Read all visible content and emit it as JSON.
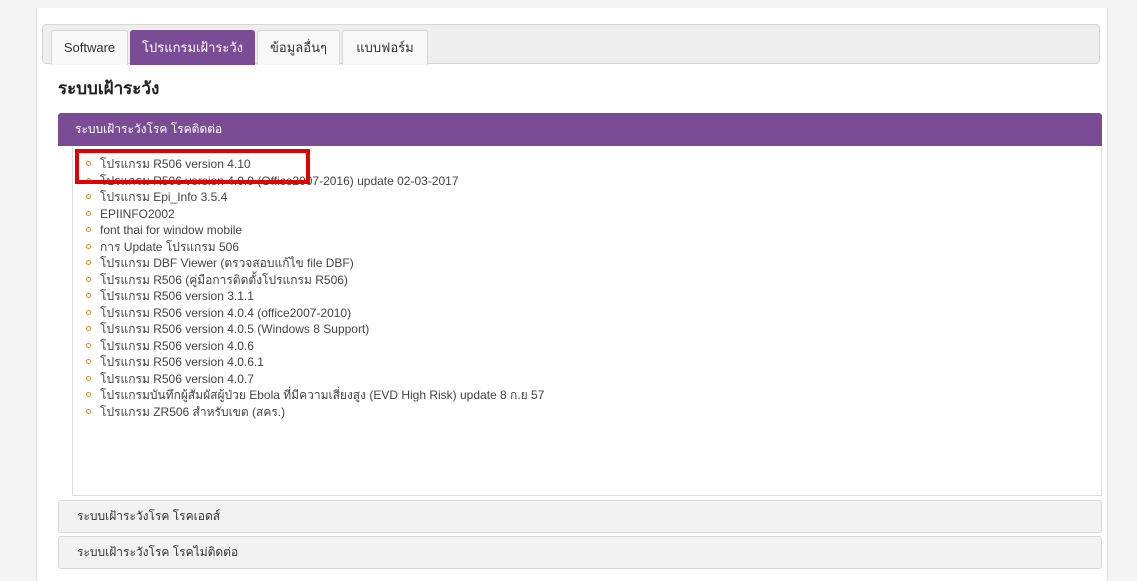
{
  "tabs": [
    {
      "label": "Software"
    },
    {
      "label": "โปรแกรมเฝ้าระวัง"
    },
    {
      "label": "ข้อมูลอื่นๆ"
    },
    {
      "label": "แบบฟอร์ม"
    }
  ],
  "active_tab_index": 1,
  "section_title": "ระบบเฝ้าระวัง",
  "accordion": {
    "active_header": "ระบบเฝ้าระวังโรค โรคติดต่อ",
    "items": [
      "โปรแกรม R506 version 4.10",
      "โปรแกรม R506 version 4.0.9 (Office2007-2016) update 02-03-2017",
      "โปรแกรม Epi_Info 3.5.4",
      "EPIINFO2002",
      "font thai for window mobile",
      "การ Update โปรแกรม 506",
      "โปรแกรม DBF Viewer (ตรวจสอบแก้ไข file DBF)",
      "โปรแกรม R506 (คู่มือการติดตั้งโปรแกรม R506)",
      "โปรแกรม R506 version 3.1.1",
      "โปรแกรม R506 version 4.0.4 (office2007-2010)",
      "โปรแกรม R506 version 4.0.5 (Windows 8 Support)",
      "โปรแกรม R506 version 4.0.6",
      "โปรแกรม R506 version 4.0.6.1",
      "โปรแกรม R506 version 4.0.7",
      "โปรแกรมบันทึกผู้สัมผัสผู้ป่วย Ebola ที่มีความเสี่ยงสูง (EVD High Risk) update 8 ก.ย 57",
      "โปรแกรม ZR506 สำหรับเขต (สคร.)"
    ],
    "collapsed_headers": [
      "ระบบเฝ้าระวังโรค โรคเอดส์",
      "ระบบเฝ้าระวังโรค โรคไม่ติดต่อ"
    ]
  },
  "colors": {
    "accent": "#7a4c96",
    "bullet": "#e38b2c",
    "highlight": "#e00000"
  }
}
